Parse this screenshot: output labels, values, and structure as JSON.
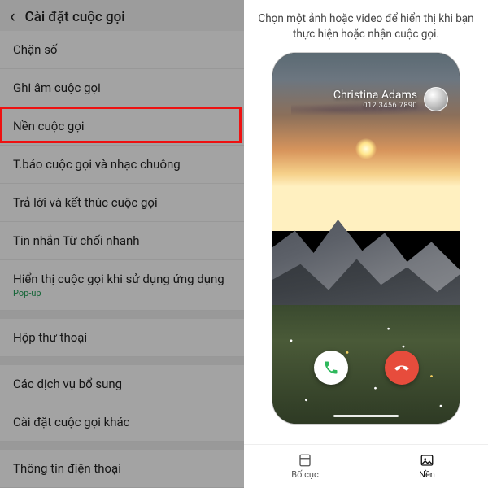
{
  "left": {
    "title": "Cài đặt cuộc gọi",
    "items": [
      {
        "label": "Chặn số"
      },
      {
        "label": "Ghi âm cuộc gọi"
      },
      {
        "label": "Nền cuộc gọi",
        "highlighted": true
      },
      {
        "label": "T.báo cuộc gọi và nhạc chuông"
      },
      {
        "label": "Trả lời và kết thúc cuộc gọi"
      },
      {
        "label": "Tin nhắn Từ chối nhanh"
      },
      {
        "label": "Hiển thị cuộc gọi khi sử dụng ứng dụng",
        "sub": "Pop-up"
      }
    ],
    "items2": [
      {
        "label": "Hộp thư thoại"
      }
    ],
    "items3": [
      {
        "label": "Các dịch vụ bổ sung"
      },
      {
        "label": "Cài đặt cuộc gọi khác"
      }
    ],
    "items4": [
      {
        "label": "Thông tin điện thoại"
      }
    ]
  },
  "right": {
    "instruction": "Chọn một ảnh hoặc video để hiển thị khi bạn thực hiện hoặc nhận cuộc gọi.",
    "caller": {
      "name": "Christina Adams",
      "number": "012 3456 7890"
    },
    "tabs": {
      "layout": "Bố cục",
      "background": "Nền"
    }
  }
}
